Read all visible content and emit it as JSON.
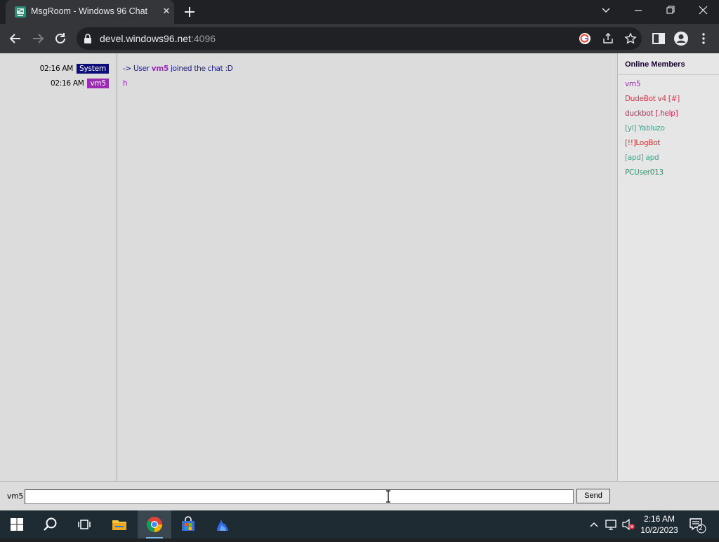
{
  "browser": {
    "tab_title": "MsgRoom - Windows 96 Chat",
    "url_host": "devel.windows96.net",
    "url_port": ":4096"
  },
  "chat": {
    "messages": [
      {
        "time": "02:16 AM",
        "nick": "System",
        "nick_color": "#0b0b7a",
        "text_prefix": "-> User ",
        "text_user": "vm5",
        "text_suffix": " joined the chat :D"
      },
      {
        "time": "02:16 AM",
        "nick": "vm5",
        "nick_color": "#9b2bb3",
        "text": "h"
      }
    ],
    "members_title": "Online Members",
    "members": [
      {
        "name": "vm5",
        "color": "#9b2bb3"
      },
      {
        "name": "DudeBot v4 [#]",
        "color": "#d9304a"
      },
      {
        "name": "duckbot [.help]",
        "color": "#cc1f5a"
      },
      {
        "name": "[yl] Yabluzo",
        "color": "#3aa88f"
      },
      {
        "name": "[!!]LogBot",
        "color": "#d62828"
      },
      {
        "name": "[apd] apd",
        "color": "#3aa88f"
      },
      {
        "name": "PCUser013",
        "color": "#1e9b6a"
      }
    ],
    "input_nick": "vm5",
    "input_value": "",
    "send_label": "Send"
  },
  "taskbar": {
    "time": "2:16 AM",
    "date": "10/2/2023",
    "notification_count": "2"
  },
  "colors": {
    "page_bg": "#dcdcdc",
    "system_badge": "#0b0b7a",
    "user_badge": "#9b2bb3",
    "taskbar_bg": "#1f2b33"
  }
}
